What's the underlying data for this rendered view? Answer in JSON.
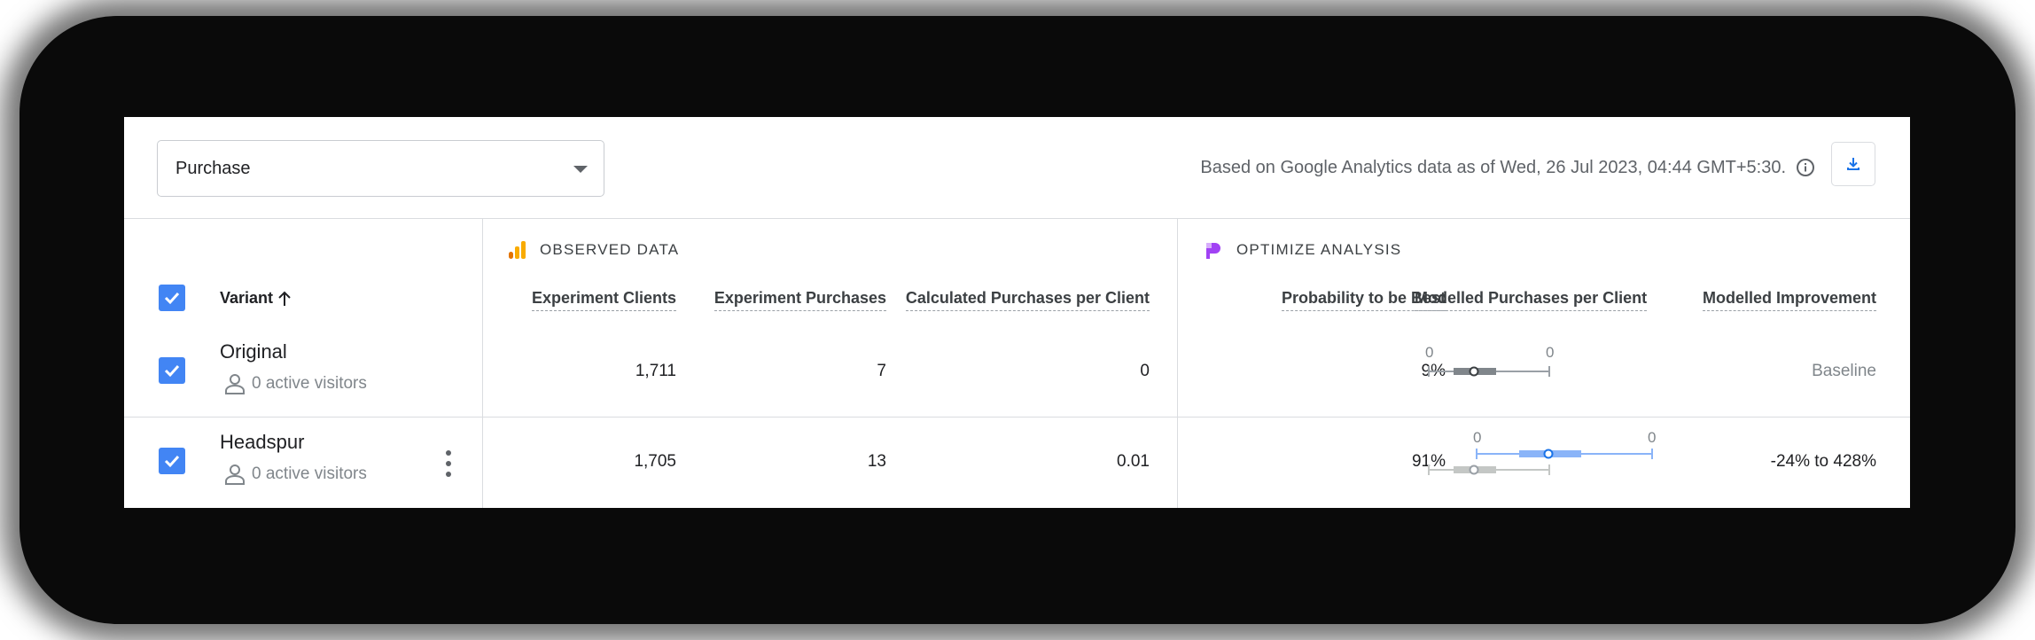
{
  "filter": {
    "metric": "Purchase"
  },
  "header": {
    "as_of": "Based on Google Analytics data as of Wed, 26 Jul 2023, 04:44 GMT+5:30."
  },
  "sections": {
    "observed": "OBSERVED DATA",
    "optimize": "OPTIMIZE ANALYSIS"
  },
  "columns": {
    "variant": "Variant",
    "experiment_clients": "Experiment Clients",
    "experiment_purchases": "Experiment Purchases",
    "calc_purchases_per_client": "Calculated Purchases per Client",
    "probability_best": "Probability to be Best",
    "modelled_ppc": "Modelled Purchases per Client",
    "modelled_improvement": "Modelled Improvement"
  },
  "rows": [
    {
      "name": "Original",
      "visitors": "0 active visitors",
      "clients": "1,711",
      "purchases": "7",
      "ppc": "0",
      "prob": "9%",
      "tick_low": "0",
      "tick_high": "0",
      "improvement": "Baseline"
    },
    {
      "name": "Headspur",
      "visitors": "0 active visitors",
      "clients": "1,705",
      "purchases": "13",
      "ppc": "0.01",
      "prob": "91%",
      "tick_low": "0",
      "tick_high": "0",
      "improvement": "-24% to 428%"
    }
  ],
  "icons": {
    "sort": "arrow-up-icon",
    "download": "download-icon",
    "info": "info-icon",
    "analytics": "analytics-logo-icon",
    "optimize": "optimize-logo-icon",
    "person": "person-icon"
  },
  "colors": {
    "accent": "#4285f4",
    "analytics_orange": "#f9ab00",
    "optimize_purple": "#a142f4",
    "range_grey": "#9aa0a6",
    "range_blue": "#8ab4f8"
  }
}
